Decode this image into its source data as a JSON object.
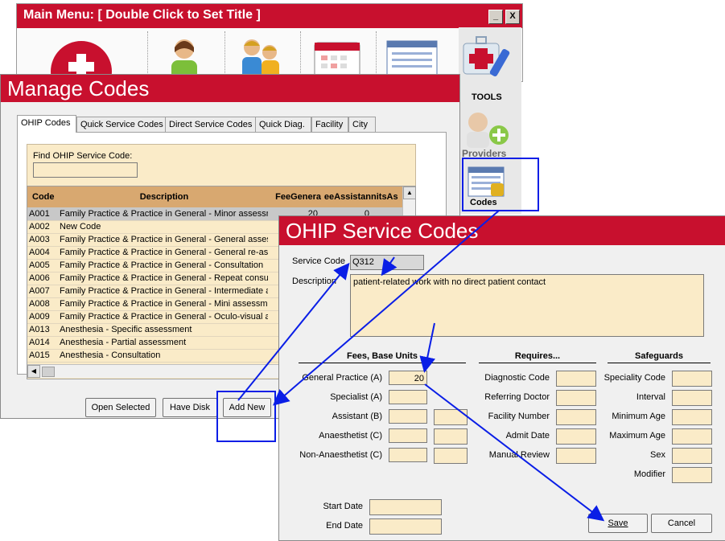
{
  "main_menu": {
    "title": "Main Menu: [ Double Click to Set Title ]",
    "minimize_label": "_",
    "close_label": "X"
  },
  "tool_panel": {
    "tools_label": "TOOLS",
    "providers_label": "Providers",
    "codes_label": "Codes"
  },
  "manage_codes": {
    "title": "Manage Codes",
    "tabs": [
      "OHIP Codes",
      "Quick Service Codes",
      "Direct Service Codes",
      "Quick Diag.",
      "Facility",
      "City"
    ],
    "find_label": "Find OHIP Service Code:",
    "find_value": "",
    "columns": [
      "Code",
      "Description",
      "FeeGenera",
      "eeAssistan",
      "nitsAs"
    ],
    "rows": [
      {
        "code": "A001",
        "description": "Family Practice & Practice in General - Minor assessme",
        "fee": "20",
        "assist": "0"
      },
      {
        "code": "A002",
        "description": "New Code",
        "fee": "",
        "assist": ""
      },
      {
        "code": "A003",
        "description": "Family Practice & Practice in General - General assess",
        "fee": "",
        "assist": ""
      },
      {
        "code": "A004",
        "description": "Family Practice & Practice in General - General re-asse",
        "fee": "",
        "assist": ""
      },
      {
        "code": "A005",
        "description": "Family Practice & Practice in General - Consultation",
        "fee": "",
        "assist": ""
      },
      {
        "code": "A006",
        "description": "Family Practice & Practice in General - Repeat consult",
        "fee": "",
        "assist": ""
      },
      {
        "code": "A007",
        "description": "Family Practice & Practice in General - Intermediate a",
        "fee": "",
        "assist": ""
      },
      {
        "code": "A008",
        "description": "Family Practice & Practice in General - Mini assessmer",
        "fee": "",
        "assist": ""
      },
      {
        "code": "A009",
        "description": "Family Practice & Practice in General - Oculo-visual as",
        "fee": "",
        "assist": ""
      },
      {
        "code": "A013",
        "description": "Anesthesia - Specific assessment",
        "fee": "",
        "assist": ""
      },
      {
        "code": "A014",
        "description": "Anesthesia - Partial assessment",
        "fee": "",
        "assist": ""
      },
      {
        "code": "A015",
        "description": "Anesthesia - Consultation",
        "fee": "",
        "assist": ""
      }
    ],
    "buttons": {
      "open_selected": "Open Selected",
      "have_disk": "Have Disk",
      "add_new": "Add New"
    }
  },
  "ohip_service_codes": {
    "title": "OHIP Service Codes",
    "service_code_label": "Service Code",
    "service_code_value": "Q312",
    "description_label": "Description",
    "description_value": "patient-related work with no direct patient contact",
    "fees_heading": "Fees, Base Units",
    "requires_heading": "Requires...",
    "safeguards_heading": "Safeguards",
    "fees": [
      {
        "label": "General Practice (A)",
        "value": "20"
      },
      {
        "label": "Specialist (A)",
        "value": ""
      },
      {
        "label": "Assistant (B)",
        "value": ""
      },
      {
        "label": "Anaesthetist (C)",
        "value": ""
      },
      {
        "label": "Non-Anaesthetist (C)",
        "value": ""
      }
    ],
    "requires": [
      "Diagnostic Code",
      "Referring Doctor",
      "Facility Number",
      "Admit Date",
      "Manual Review"
    ],
    "safeguards": [
      "Speciality Code",
      "Interval",
      "Minimum Age",
      "Maximum Age",
      "Sex",
      "Modifier"
    ],
    "start_date_label": "Start Date",
    "end_date_label": "End Date",
    "save_label": "Save",
    "cancel_label": "Cancel"
  },
  "colors": {
    "title_bar": "#c8102e",
    "field_bg": "#faebc8",
    "header_bg": "#d8a870",
    "annotation": "#0a1ee6"
  }
}
